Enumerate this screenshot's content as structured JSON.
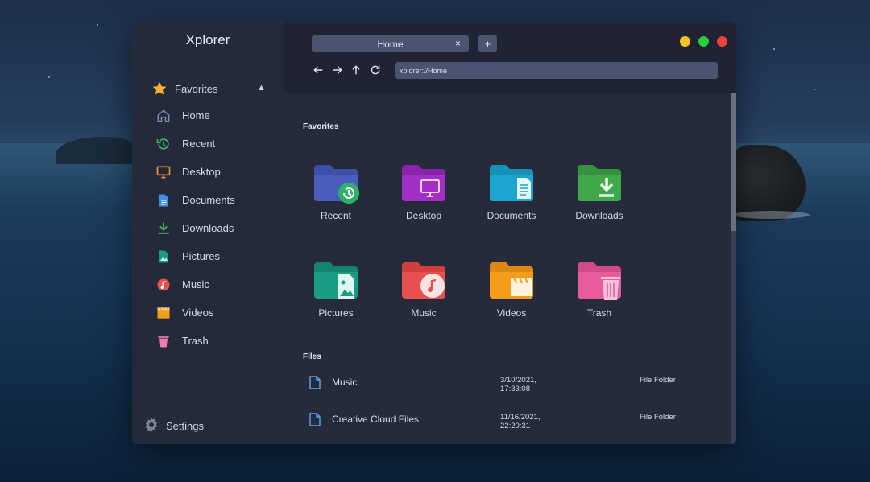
{
  "app": {
    "title": "Xplorer"
  },
  "sidebar": {
    "favorites_label": "Favorites",
    "items": [
      {
        "label": "Home",
        "icon": "home-icon"
      },
      {
        "label": "Recent",
        "icon": "recent-icon"
      },
      {
        "label": "Desktop",
        "icon": "desktop-icon"
      },
      {
        "label": "Documents",
        "icon": "documents-icon"
      },
      {
        "label": "Downloads",
        "icon": "downloads-icon"
      },
      {
        "label": "Pictures",
        "icon": "pictures-icon"
      },
      {
        "label": "Music",
        "icon": "music-icon"
      },
      {
        "label": "Videos",
        "icon": "videos-icon"
      },
      {
        "label": "Trash",
        "icon": "trash-icon"
      }
    ],
    "settings_label": "Settings"
  },
  "tabs": [
    {
      "label": "Home",
      "close": "×"
    }
  ],
  "new_tab_label": "+",
  "address": {
    "value": "xplorer://Home"
  },
  "main": {
    "favorites_title": "Favorites",
    "favorites": [
      {
        "label": "Recent",
        "color": "#4a5dbf"
      },
      {
        "label": "Desktop",
        "color": "#a12fc6"
      },
      {
        "label": "Documents",
        "color": "#1ba5cf"
      },
      {
        "label": "Downloads",
        "color": "#3ea84a"
      },
      {
        "label": "Pictures",
        "color": "#1a9b84"
      },
      {
        "label": "Music",
        "color": "#e84f4f"
      },
      {
        "label": "Videos",
        "color": "#f59c1a"
      },
      {
        "label": "Trash",
        "color": "#e85c9b"
      }
    ],
    "files_title": "Files",
    "files": [
      {
        "name": "Music",
        "date_line1": "3/10/2021,",
        "date_line2": "17:33:08",
        "type": "File Folder"
      },
      {
        "name": "Creative Cloud Files",
        "date_line1": "11/16/2021,",
        "date_line2": "22:20:31",
        "type": "File Folder"
      }
    ]
  },
  "colors": {
    "window_bg": "#252a3b",
    "accent": "#4a5370",
    "traffic_yellow": "#f4c321",
    "traffic_green": "#2ecc40",
    "traffic_red": "#f2413d"
  }
}
